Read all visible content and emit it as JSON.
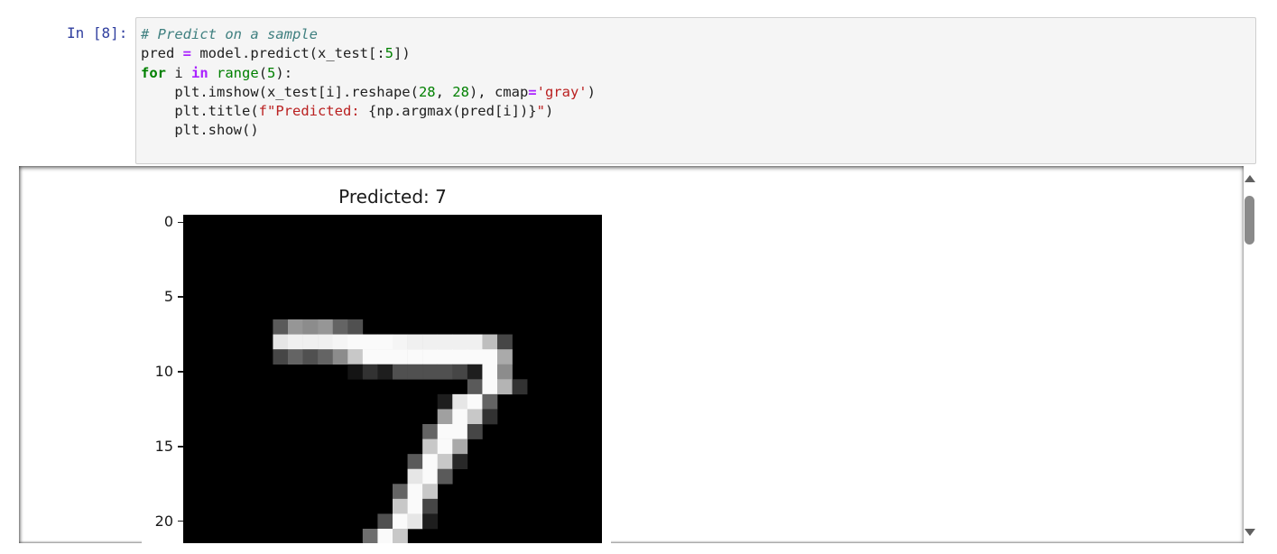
{
  "cell": {
    "prompt": "In [8]:",
    "code_lines": [
      "# Predict on a sample",
      "pred = model.predict(x_test[:5])",
      "for i in range(5):",
      "    plt.imshow(x_test[i].reshape(28, 28), cmap='gray')",
      "    plt.title(f\"Predicted: {np.argmax(pred[i])}\")",
      "    plt.show()"
    ]
  },
  "output": {
    "figure": {
      "title": "Predicted: 7",
      "y_tick_labels": [
        "0",
        "5",
        "10",
        "15",
        "20"
      ],
      "colormap": "gray"
    }
  },
  "chart_data": {
    "type": "heatmap",
    "title": "Predicted: 7",
    "yticks": [
      0,
      5,
      10,
      15,
      20
    ],
    "visible_rows": [
      0,
      21
    ],
    "cols": 28,
    "pixel_values": {
      "7": {
        "6": 90,
        "7": 150,
        "8": 140,
        "9": 150,
        "10": 100,
        "11": 80
      },
      "8": {
        "6": 230,
        "7": 240,
        "8": 240,
        "9": 240,
        "10": 245,
        "11": 250,
        "12": 250,
        "13": 250,
        "14": 245,
        "15": 240,
        "16": 240,
        "17": 240,
        "18": 240,
        "19": 240,
        "20": 190,
        "21": 70
      },
      "9": {
        "6": 70,
        "7": 100,
        "8": 80,
        "9": 100,
        "10": 140,
        "11": 200,
        "12": 250,
        "13": 250,
        "14": 250,
        "15": 250,
        "16": 250,
        "17": 250,
        "18": 250,
        "19": 250,
        "20": 250,
        "21": 170
      },
      "10": {
        "11": 20,
        "12": 50,
        "13": 30,
        "14": 80,
        "15": 80,
        "16": 80,
        "17": 80,
        "18": 70,
        "19": 30,
        "20": 250,
        "21": 140
      },
      "11": {
        "19": 90,
        "20": 250,
        "21": 180,
        "22": 50
      },
      "12": {
        "17": 30,
        "18": 230,
        "19": 250,
        "20": 100
      },
      "13": {
        "17": 160,
        "18": 250,
        "19": 200,
        "20": 50
      },
      "14": {
        "16": 100,
        "17": 250,
        "18": 250,
        "19": 70
      },
      "15": {
        "16": 200,
        "17": 250,
        "18": 170
      },
      "16": {
        "15": 90,
        "16": 250,
        "17": 200,
        "18": 40
      },
      "17": {
        "15": 230,
        "16": 250,
        "17": 90
      },
      "18": {
        "14": 100,
        "15": 250,
        "16": 200
      },
      "19": {
        "14": 200,
        "15": 250,
        "16": 70
      },
      "20": {
        "13": 80,
        "14": 250,
        "15": 230,
        "16": 30
      },
      "21": {
        "12": 110,
        "13": 250,
        "14": 200
      }
    }
  }
}
